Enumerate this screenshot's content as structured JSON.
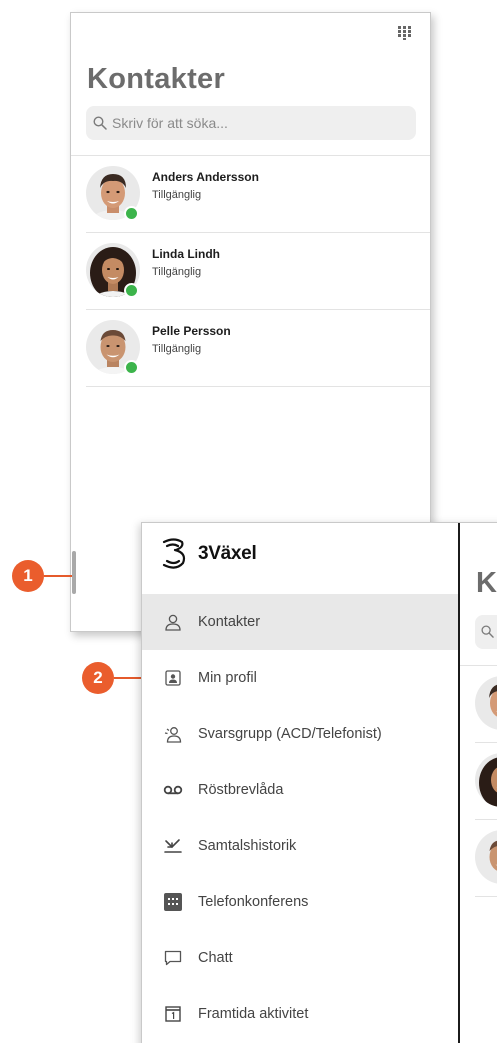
{
  "contacts_screen": {
    "title": "Kontakter",
    "search_placeholder": "Skriv för att söka...",
    "contacts": [
      {
        "name": "Anders Andersson",
        "status": "Tillgänglig"
      },
      {
        "name": "Linda Lindh",
        "status": "Tillgänglig"
      },
      {
        "name": "Pelle Persson",
        "status": "Tillgänglig"
      }
    ]
  },
  "callouts": {
    "one": "1",
    "two": "2"
  },
  "drawer": {
    "brand_name": "3Växel",
    "menu": [
      {
        "label": "Kontakter",
        "icon": "person-icon",
        "active": true
      },
      {
        "label": "Min profil",
        "icon": "profile-card-icon",
        "active": false
      },
      {
        "label": "Svarsgrupp (ACD/Telefonist)",
        "icon": "group-icon",
        "active": false
      },
      {
        "label": "Röstbrevlåda",
        "icon": "voicemail-icon",
        "active": false
      },
      {
        "label": "Samtalshistorik",
        "icon": "call-history-icon",
        "active": false
      },
      {
        "label": "Telefonkonferens",
        "icon": "conference-icon",
        "active": false
      },
      {
        "label": "Chatt",
        "icon": "chat-icon",
        "active": false
      },
      {
        "label": "Framtida aktivitet",
        "icon": "calendar-icon",
        "active": false
      }
    ]
  },
  "background_screen": {
    "title_fragment": "K"
  },
  "colors": {
    "status_available": "#3cb44b",
    "callout": "#ea5d2d",
    "title_gray": "#6c6c6c",
    "active_menu_bg": "#e8e8e8"
  }
}
